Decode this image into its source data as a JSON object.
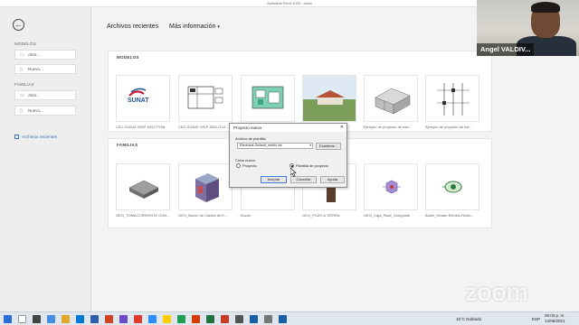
{
  "window": {
    "title": "Autodesk Revit 2020 - Inicio",
    "controls": [
      "–",
      "□",
      "✕"
    ]
  },
  "sidebar": {
    "back_icon": "back-arrow-icon",
    "modelos_heading": "MODELOS",
    "modelos_open": "Abrir...",
    "modelos_new": "Nuevo...",
    "familias_heading": "FAMILIAS",
    "familias_open": "Abrir...",
    "familias_new": "Nuevo...",
    "recent_link": "Archivos recientes"
  },
  "header": {
    "tab_recent": "Archivos recientes",
    "tab_more": "Más información",
    "more_caret": "▾"
  },
  "models": {
    "title": "MODELOS",
    "items": [
      {
        "caption": "CEC-SUNAT-WSP-DED-ITOM..."
      },
      {
        "caption": "CEC-SUNAT-WSP-DED-ITLE..."
      },
      {
        "caption": "CEC-SUNAT-WSP-DED-ITLE..."
      },
      {
        "caption": ""
      },
      {
        "caption": "Ejemplo de proyecto de estr..."
      },
      {
        "caption": "Ejemplo de proyecto de est..."
      }
    ],
    "sunat_text": "SUNAT"
  },
  "families": {
    "title": "FAMILIAS",
    "items": [
      {
        "caption": "GEO_TOMACORRIENTE CON..."
      },
      {
        "caption": "GEO_Buzon de Cables de E..."
      },
      {
        "caption": "Buzon"
      },
      {
        "caption": "GEO_POZO A TIERRA"
      },
      {
        "caption": "GEO_Caja_Pase_Octogonal"
      },
      {
        "caption": "Boiler_Heater-Electric-Resid..."
      }
    ]
  },
  "dialog": {
    "title": "Proyecto nuevo",
    "close": "✕",
    "group_template": "Archivo de plantilla",
    "template_value": "Electrical-Default_metric.rte",
    "browse": "Examinar...",
    "group_create": "Crear nuevo",
    "radio_project": "Proyecto",
    "radio_template": "Plantilla de proyecto",
    "ok": "Aceptar",
    "cancel": "Cancelar",
    "help": "Ayuda"
  },
  "webcam": {
    "name": "Angel VALDIV..."
  },
  "zoom_logo": "zoom",
  "taskbar": {
    "weather": "15°C  Nublado",
    "time": "06:03 p. m.",
    "date": "14/06/2021",
    "lang": "ESP"
  },
  "colors": {
    "accent": "#3b6fb6",
    "sunat_red": "#c8102e",
    "sunat_blue": "#1d4f91"
  }
}
